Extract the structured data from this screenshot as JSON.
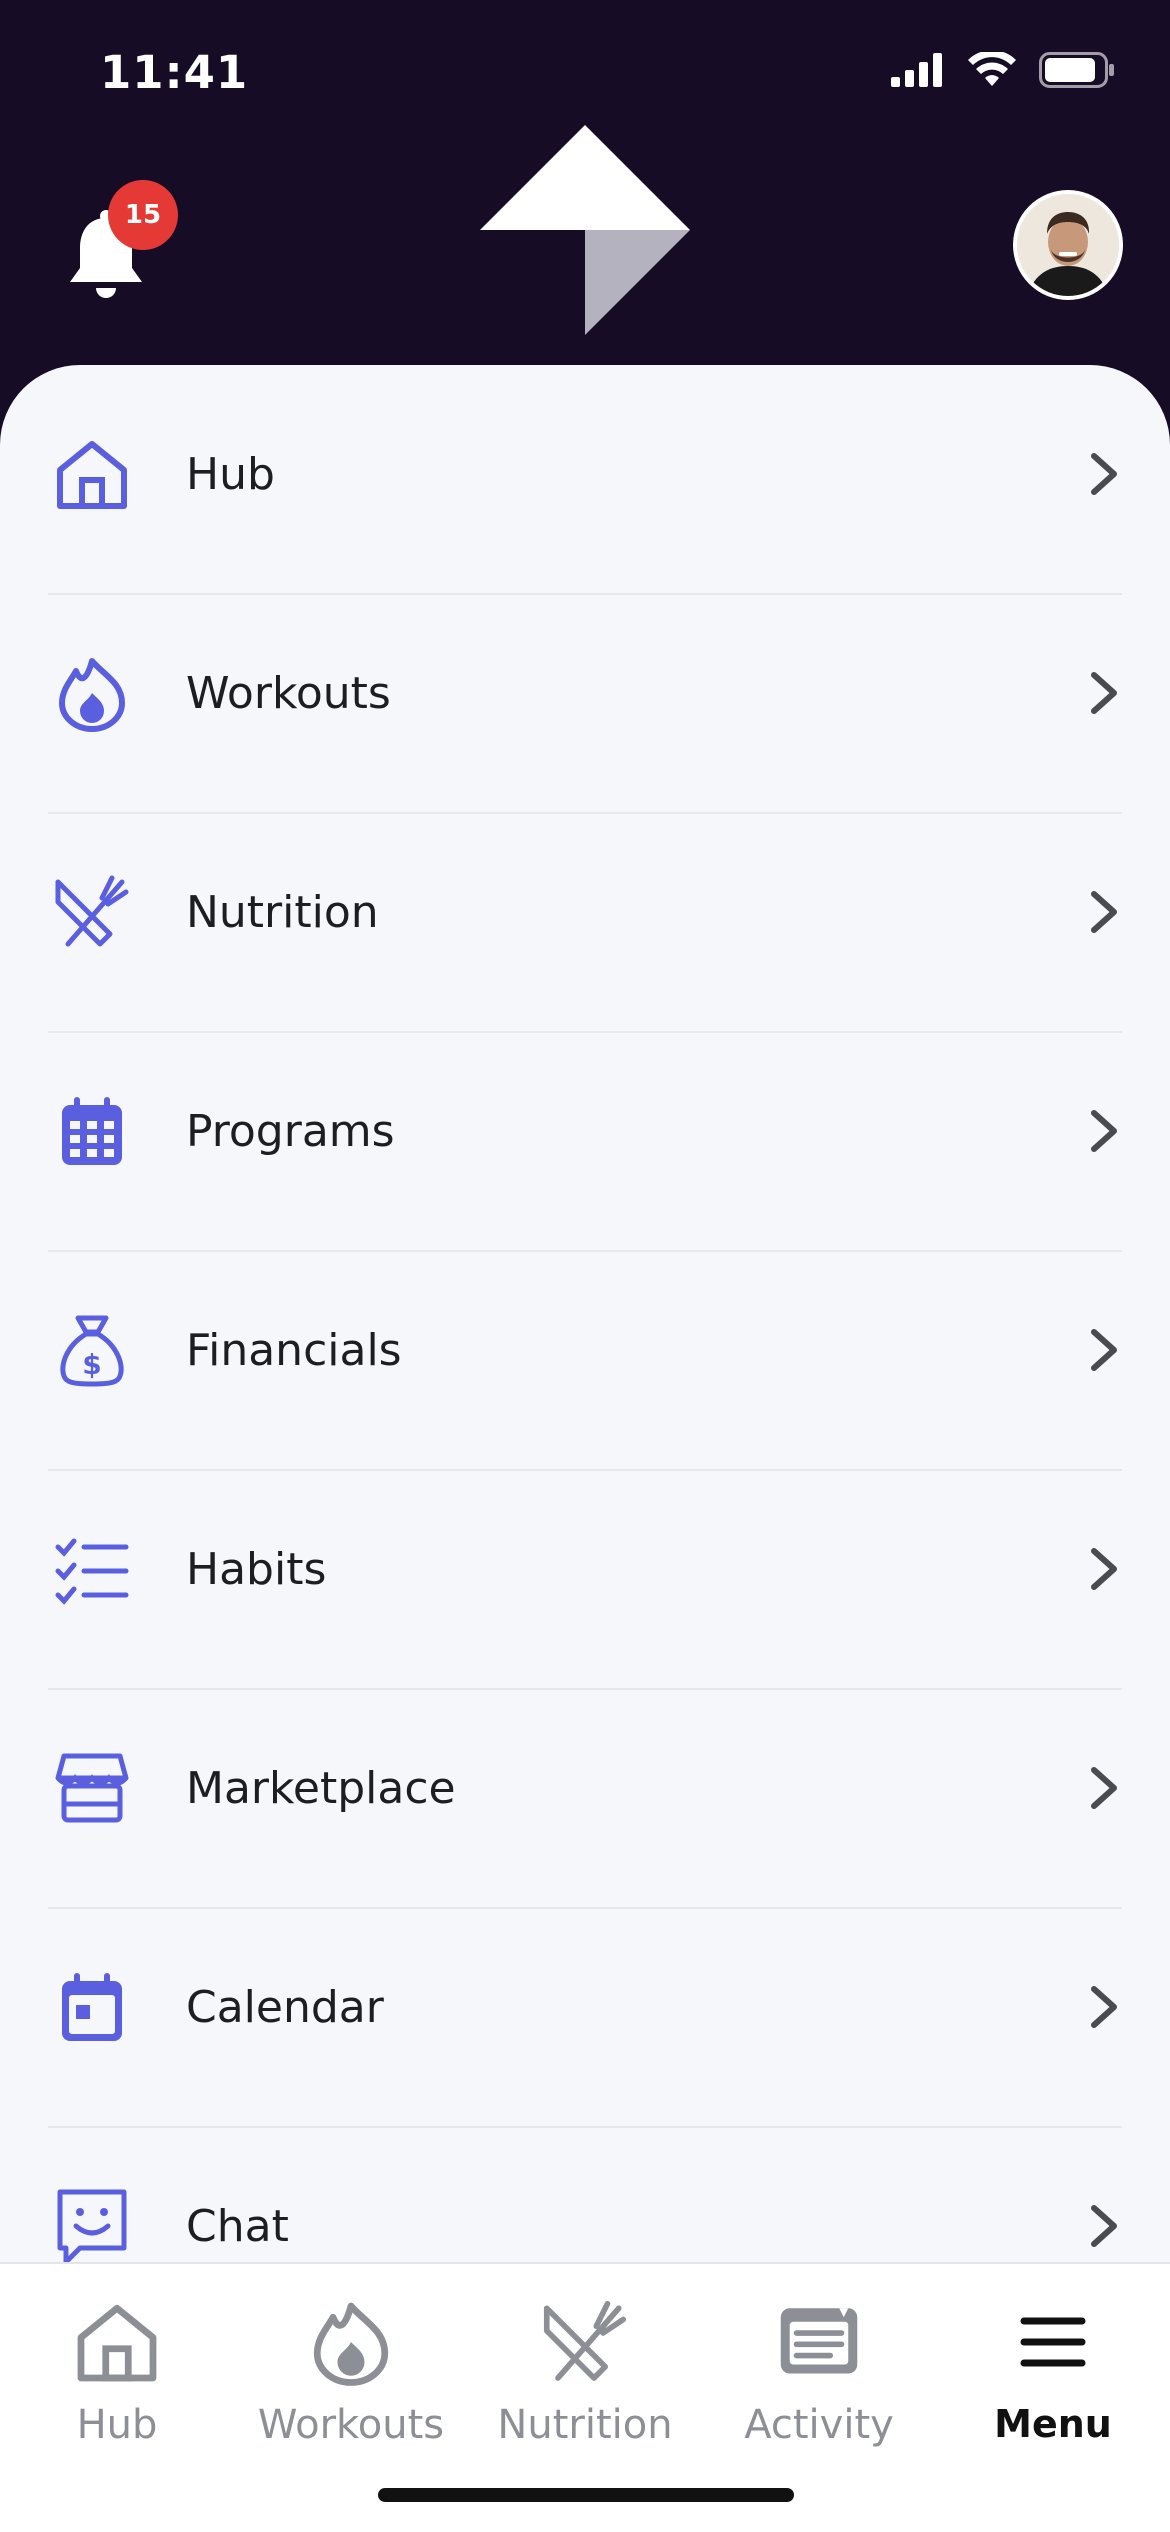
{
  "status": {
    "time": "11:41"
  },
  "header": {
    "notification_count": "15"
  },
  "menu": {
    "items": [
      {
        "label": "Hub",
        "icon": "home-icon"
      },
      {
        "label": "Workouts",
        "icon": "flame-icon"
      },
      {
        "label": "Nutrition",
        "icon": "utensils-icon"
      },
      {
        "label": "Programs",
        "icon": "calendar-grid-icon"
      },
      {
        "label": "Financials",
        "icon": "money-bag-icon"
      },
      {
        "label": "Habits",
        "icon": "checklist-icon"
      },
      {
        "label": "Marketplace",
        "icon": "store-icon"
      },
      {
        "label": "Calendar",
        "icon": "calendar-icon"
      },
      {
        "label": "Chat",
        "icon": "chat-icon"
      }
    ]
  },
  "tabbar": {
    "tabs": [
      {
        "label": "Hub",
        "icon": "home-icon"
      },
      {
        "label": "Workouts",
        "icon": "flame-icon"
      },
      {
        "label": "Nutrition",
        "icon": "utensils-icon"
      },
      {
        "label": "Activity",
        "icon": "activity-card-icon"
      },
      {
        "label": "Menu",
        "icon": "hamburger-icon",
        "active": true
      }
    ]
  },
  "colors": {
    "header_bg": "#170c26",
    "accent": "#5a5fe0",
    "badge": "#e53935",
    "sheet_bg": "#f6f7fb"
  }
}
